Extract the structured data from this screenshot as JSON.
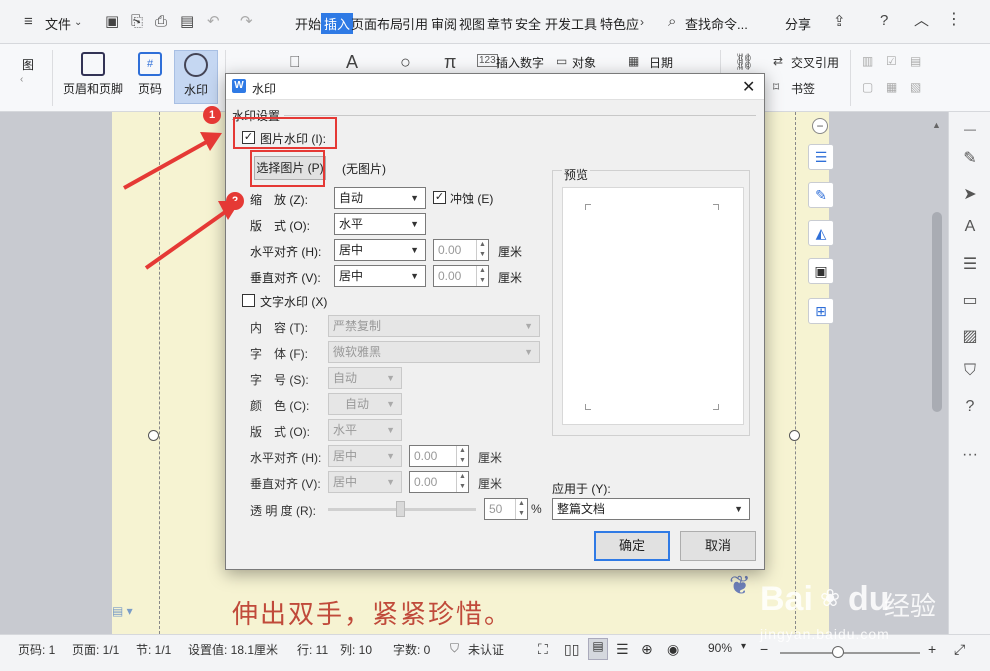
{
  "menubar": {
    "file_label": "文件",
    "tabs": [
      "开始",
      "插入",
      "页面布局",
      "引用",
      "审阅",
      "视图",
      "章节",
      "安全",
      "开发工具",
      "特色应"
    ],
    "active_tab": "插入",
    "search_label": "查找命令...",
    "share_label": "分享"
  },
  "ribbon": {
    "left_fragment": "图",
    "header_footer": "页眉和页脚",
    "page_number": "页码",
    "watermark": "水印",
    "insert_number": "插入数字",
    "object": "对象",
    "date": "日期",
    "cross_ref": "交叉引用",
    "bookmark": "书签"
  },
  "document": {
    "text": "伸出双手，紧紧珍惜。"
  },
  "dialog": {
    "title": "水印",
    "group_label": "水印设置",
    "picture_watermark": {
      "label": "图片水印 (I):",
      "checked": true,
      "select_picture": "选择图片 (P)",
      "no_picture": "(无图片)",
      "scale_label": "缩　放 (Z):",
      "scale_value": "自动",
      "washout_label": "冲蚀 (E)",
      "washout_checked": true,
      "layout_label": "版　式 (O):",
      "layout_value": "水平",
      "h_align_label": "水平对齐 (H):",
      "h_align_value": "居中",
      "h_offset": "0.00",
      "v_align_label": "垂直对齐 (V):",
      "v_align_value": "居中",
      "v_offset": "0.00",
      "unit": "厘米"
    },
    "text_watermark": {
      "label": "文字水印 (X)",
      "checked": false,
      "content_label": "内　容 (T):",
      "content_value": "严禁复制",
      "font_label": "字　体 (F):",
      "font_value": "微软雅黑",
      "size_label": "字　号 (S):",
      "size_value": "自动",
      "color_label": "颜　色 (C):",
      "color_value": "自动",
      "layout_label": "版　式 (O):",
      "layout_value": "水平",
      "h_align_label": "水平对齐 (H):",
      "h_align_value": "居中",
      "h_offset": "0.00",
      "v_align_label": "垂直对齐 (V):",
      "v_align_value": "居中",
      "v_offset": "0.00",
      "unit": "厘米",
      "transparency_label": "透 明 度 (R):",
      "transparency_value": "50",
      "transparency_unit": "%"
    },
    "preview_label": "预览",
    "apply_to_label": "应用于 (Y):",
    "apply_to_value": "整篇文档",
    "ok_label": "确定",
    "cancel_label": "取消"
  },
  "annotations": {
    "badge1": "1",
    "badge2": "2"
  },
  "statusbar": {
    "page_num": "页码: 1",
    "pages": "页面: 1/1",
    "section": "节: 1/1",
    "setting": "设置值: 18.1厘米",
    "row": "行: 11",
    "col": "列: 10",
    "word_count": "字数: 0",
    "auth": "未认证",
    "zoom": "90%"
  },
  "watermark_logo": {
    "text1": "Bai",
    "text2": "du",
    "text3": "经验",
    "url": "jingyan.baidu.com"
  },
  "colors": {
    "accent": "#2f7ae5",
    "annotation_red": "#e53935",
    "page_bg": "#f6f3d2"
  }
}
